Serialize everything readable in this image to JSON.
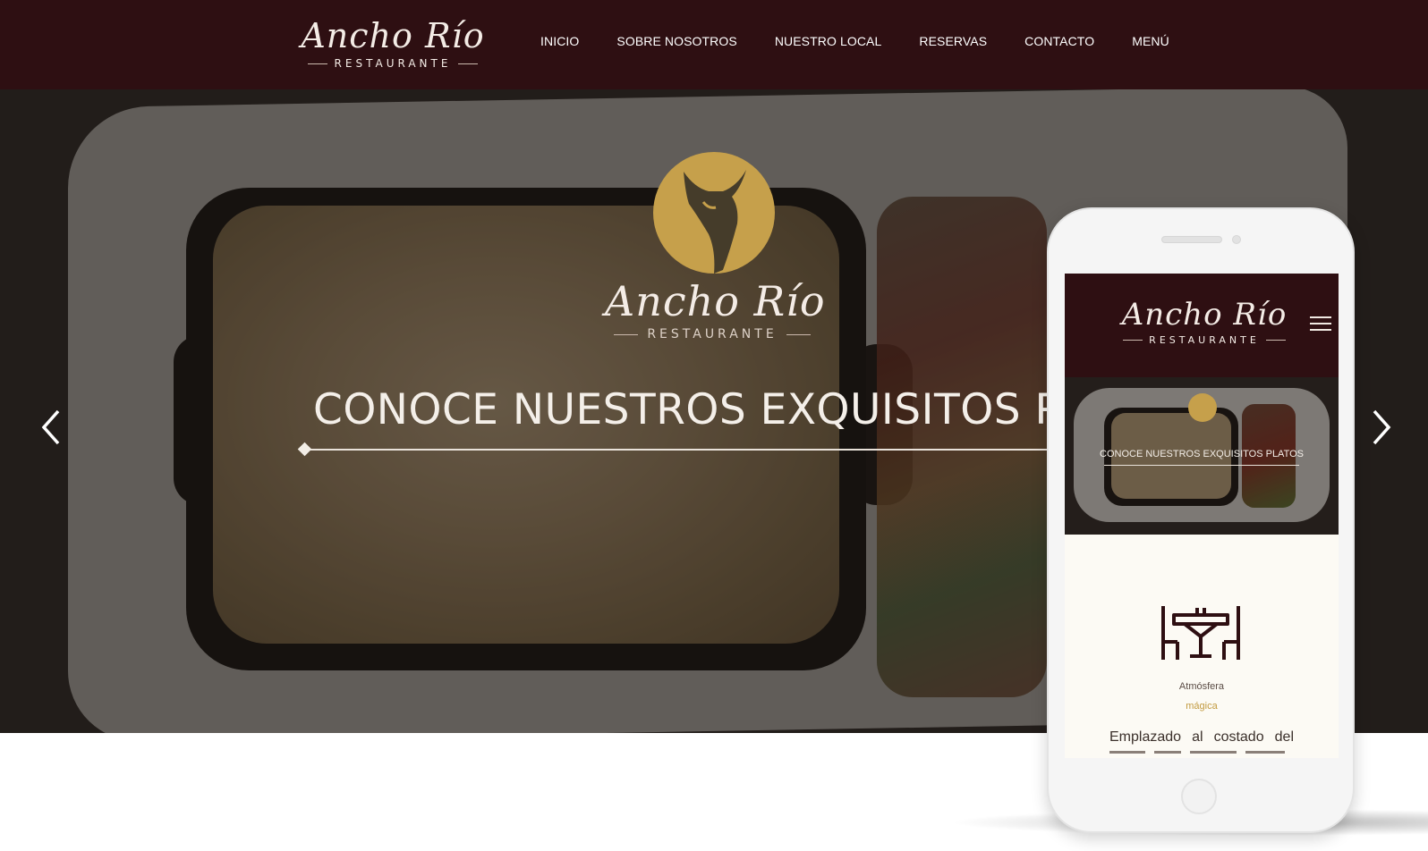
{
  "brand": {
    "script_name": "Ancho Río",
    "subtitle": "RESTAURANTE"
  },
  "nav": {
    "items": [
      "INICIO",
      "SOBRE NOSOTROS",
      "NUESTRO LOCAL",
      "RESERVAS",
      "CONTACTO",
      "MENÚ"
    ]
  },
  "hero": {
    "title": "CONOCE NUESTROS EXQUISITOS PLA",
    "prev_icon": "chevron-left-icon",
    "next_icon": "chevron-right-icon",
    "emblem_icon": "bull-emblem-icon"
  },
  "mobile": {
    "menu_icon": "hamburger-menu-icon",
    "hero_title": "CONOCE NUESTROS EXQUISITOS PLATOS",
    "feature_icon": "dining-table-icon",
    "feature_label": "Atmósfera",
    "feature_sublabel": "mágica",
    "feature_text": "Emplazado al costado del"
  },
  "colors": {
    "header_bg": "#2e0f12",
    "gold": "#c6a04b",
    "cream": "#fcfaf4",
    "text_light": "#f4efe9"
  }
}
